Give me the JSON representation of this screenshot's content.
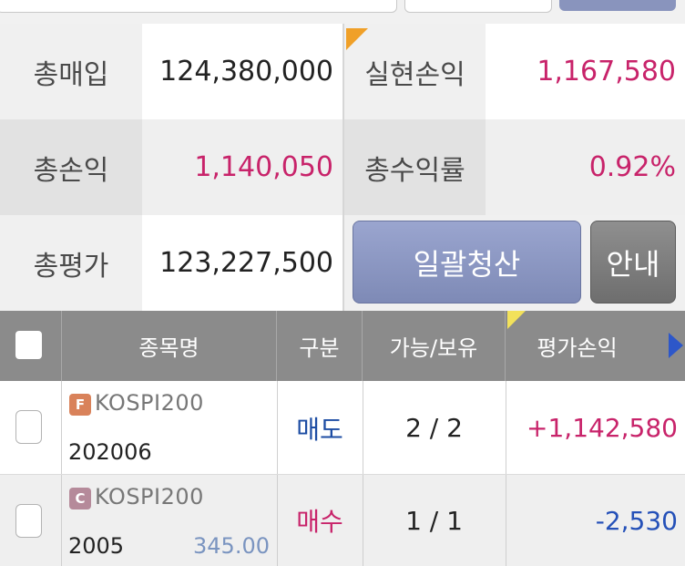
{
  "summary": {
    "total_purchase_label": "총매입",
    "total_purchase_value": "124,380,000",
    "realized_pnl_label": "실현손익",
    "realized_pnl_value": "1,167,580",
    "total_pnl_label": "총손익",
    "total_pnl_value": "1,140,050",
    "total_return_label": "총수익률",
    "total_return_value": "0.92%",
    "total_eval_label": "총평가",
    "total_eval_value": "123,227,500",
    "liquidate_button": "일괄청산",
    "guide_button": "안내"
  },
  "table": {
    "headers": {
      "name": "종목명",
      "type": "구분",
      "qty": "가능/보유",
      "eval_pnl": "평가손익"
    },
    "rows": [
      {
        "badge": "F",
        "name": "KOSPI200",
        "code": "202006",
        "sub": "",
        "type": "매도",
        "qty": "2 / 2",
        "pnl": "+1,142,580"
      },
      {
        "badge": "C",
        "name": "KOSPI200",
        "code": "2005",
        "sub": "345.00",
        "type": "매수",
        "qty": "1 / 1",
        "pnl": "-2,530"
      }
    ]
  },
  "colors": {
    "positive": "#c8236a",
    "negative": "#2450b8",
    "sell": "#1c4ca3",
    "buy": "#c8236a",
    "button_primary": "#8994bd",
    "header_bg": "#8b8b8b"
  }
}
